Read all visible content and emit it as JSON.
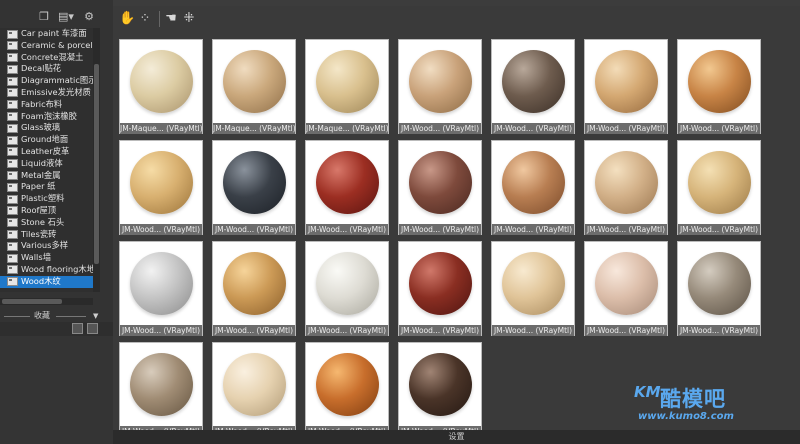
{
  "left_toolbar": {
    "icons": [
      "copy-window-icon",
      "view-mode-dropdown-icon",
      "settings-gear-icon"
    ]
  },
  "categories": [
    {
      "label": "Car paint 车漆面"
    },
    {
      "label": "Ceramic & porcelai"
    },
    {
      "label": "Concrete混凝土"
    },
    {
      "label": "Decal贴花"
    },
    {
      "label": "Diagrammatic图示"
    },
    {
      "label": "Emissive发光材质"
    },
    {
      "label": "Fabric布料"
    },
    {
      "label": "Foam泡沫橡胶"
    },
    {
      "label": "Glass玻璃"
    },
    {
      "label": "Ground地面"
    },
    {
      "label": "Leather皮革"
    },
    {
      "label": "Liquid液体"
    },
    {
      "label": "Metal金属"
    },
    {
      "label": "Paper 纸"
    },
    {
      "label": "Plastic塑料"
    },
    {
      "label": "Roof屋顶"
    },
    {
      "label": "Stone 石头"
    },
    {
      "label": "Tiles瓷砖"
    },
    {
      "label": "Various多样"
    },
    {
      "label": "Walls墙"
    },
    {
      "label": "Wood flooring木地板"
    },
    {
      "label": "Wood木纹",
      "selected": true
    }
  ],
  "favorites": {
    "label": "收藏"
  },
  "main_toolbar": {
    "icons": [
      "material-pick-icon",
      "material-add-icon",
      "material-hand-icon",
      "material-grid-icon"
    ]
  },
  "materials": [
    {
      "caption": "JM-Maque... (VRayMtl)",
      "colors": [
        "#f4ecd8",
        "#dccca3",
        "#a8916a"
      ]
    },
    {
      "caption": "JM-Maque... (VRayMtl)",
      "colors": [
        "#f0dcc0",
        "#caa87c",
        "#8e6e48"
      ]
    },
    {
      "caption": "JM-Maque... (VRayMtl)",
      "colors": [
        "#f4e7c8",
        "#d9c08e",
        "#9c8456"
      ]
    },
    {
      "caption": "JM-Wood... (VRayMtl)",
      "colors": [
        "#f1ddc2",
        "#c9a27a",
        "#8c6a44"
      ]
    },
    {
      "caption": "JM-Wood... (VRayMtl)",
      "colors": [
        "#b8a89a",
        "#6e5c4e",
        "#3a2e26"
      ]
    },
    {
      "caption": "JM-Wood... (VRayMtl)",
      "colors": [
        "#f3dcb8",
        "#d4a872",
        "#94683c"
      ]
    },
    {
      "caption": "JM-Wood... (VRayMtl)",
      "colors": [
        "#f2c890",
        "#c88446",
        "#7e4a1e"
      ]
    },
    {
      "caption": "JM-Wood... (VRayMtl)",
      "colors": [
        "#f6dca6",
        "#d8b070",
        "#9a7238"
      ]
    },
    {
      "caption": "JM-Wood... (VRayMtl)",
      "colors": [
        "#8a929c",
        "#3a4048",
        "#1c2026"
      ]
    },
    {
      "caption": "JM-Wood... (VRayMtl)",
      "colors": [
        "#d8786a",
        "#9c2e22",
        "#5a1410"
      ]
    },
    {
      "caption": "JM-Wood... (VRayMtl)",
      "colors": [
        "#c89888",
        "#7e4a3c",
        "#4a2820"
      ]
    },
    {
      "caption": "JM-Wood... (VRayMtl)",
      "colors": [
        "#f0c8a0",
        "#b87e52",
        "#7a4a2a"
      ]
    },
    {
      "caption": "JM-Wood... (VRayMtl)",
      "colors": [
        "#f4e0c0",
        "#d2b088",
        "#9a7650"
      ]
    },
    {
      "caption": "JM-Wood... (VRayMtl)",
      "colors": [
        "#f4e0b4",
        "#d6b47a",
        "#9a7846"
      ]
    },
    {
      "caption": "JM-Wood... (VRayMtl)",
      "colors": [
        "#f2f2f2",
        "#c4c4c4",
        "#8a8a8a"
      ]
    },
    {
      "caption": "JM-Wood... (VRayMtl)",
      "colors": [
        "#f6d49a",
        "#cc9a56",
        "#8a5e2a"
      ]
    },
    {
      "caption": "JM-Wood... (VRayMtl)",
      "colors": [
        "#fafaf6",
        "#dedcd4",
        "#a8a69c"
      ]
    },
    {
      "caption": "JM-Wood... (VRayMtl)",
      "colors": [
        "#d0786a",
        "#8a2e22",
        "#4e1410"
      ]
    },
    {
      "caption": "JM-Wood... (VRayMtl)",
      "colors": [
        "#f8ead0",
        "#e0c498",
        "#a88a5e"
      ]
    },
    {
      "caption": "JM-Wood... (VRayMtl)",
      "colors": [
        "#f8e8dc",
        "#dcbeaa",
        "#a48876"
      ]
    },
    {
      "caption": "JM-Wood... (VRayMtl)",
      "colors": [
        "#d4ccc0",
        "#968a7a",
        "#5a5044"
      ]
    },
    {
      "caption": "JM-Wood... (VRayMtl)",
      "colors": [
        "#d8ccbc",
        "#a08c74",
        "#645440"
      ]
    },
    {
      "caption": "JM-Wood... (VRayMtl)",
      "colors": [
        "#faf0e0",
        "#e6d2b0",
        "#b09a76"
      ]
    },
    {
      "caption": "JM-Wood... (VRayMtl)",
      "colors": [
        "#f6b870",
        "#c86e2c",
        "#7e3c10"
      ]
    },
    {
      "caption": "JM-Wood... (VRayMtl)",
      "colors": [
        "#a08474",
        "#4a3428",
        "#241812"
      ]
    }
  ],
  "status": {
    "text": "设置"
  },
  "watermark": {
    "logo": "KM",
    "name": "酷模吧",
    "url": "www.kumo8.com"
  }
}
